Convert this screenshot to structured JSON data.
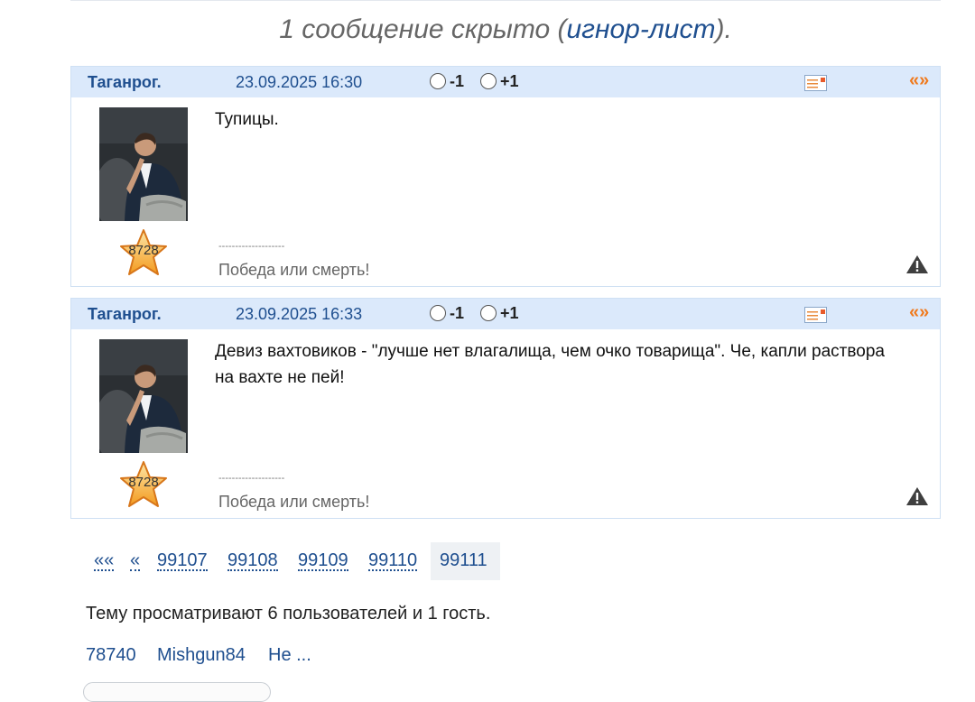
{
  "notice": {
    "prefix": "1 сообщение скрыто (",
    "link": "игнор-лист",
    "suffix": ")."
  },
  "posts": [
    {
      "author": "Таганрог.",
      "date": "23.09.2025 16:30",
      "vote_minus": "-1",
      "vote_plus": "+1",
      "quote": "«»",
      "rank": "8728",
      "text": "Тупицы.",
      "signature_sep": "--------------------",
      "signature": "Победа или смерть!"
    },
    {
      "author": "Таганрог.",
      "date": "23.09.2025 16:33",
      "vote_minus": "-1",
      "vote_plus": "+1",
      "quote": "«»",
      "rank": "8728",
      "text": "Девиз вахтовиков - \"лучше нет влагалища, чем очко товарища\". Че, капли раствора на вахте не пей!",
      "signature_sep": "--------------------",
      "signature": "Победа или смерть!"
    }
  ],
  "pagination": {
    "first": "««",
    "prev": "«",
    "pages": [
      "99107",
      "99108",
      "99109",
      "99110"
    ],
    "current": "99111"
  },
  "viewers": {
    "text": "Тему просматривают 6 пользователей и 1 гость.",
    "users": [
      "78740",
      "Mishgun84",
      "Не ..."
    ]
  },
  "colors": {
    "link": "#1f4f8f",
    "header_bg": "#dbe9fb",
    "quote": "#f07a1d",
    "star": "#f4a52a"
  }
}
